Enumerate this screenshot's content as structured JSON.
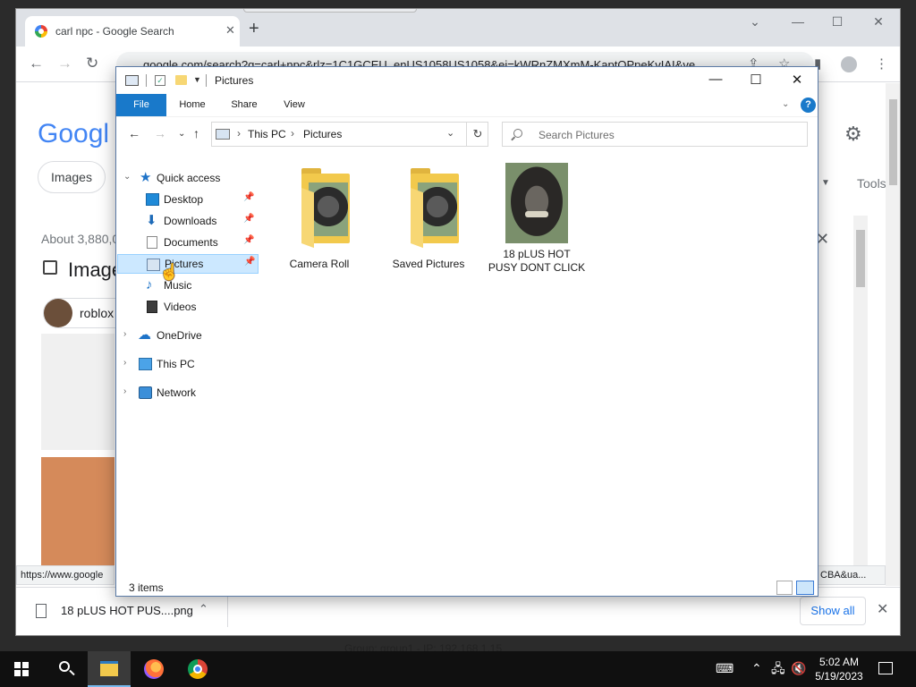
{
  "vm_caption": "Group: group1 - IP: 192.168.1.15",
  "chrome": {
    "tab_title": "carl npc - Google Search",
    "tab_close": "✕",
    "new_tab": "+",
    "url": "google.com/search?q=carl+npc&rlz=1C1GCEU_enUS1058US1058&ei=kWRnZMXmM-KaptQPpeKvIAI&ve",
    "status_url": "https://www.google",
    "status_url_right": "CBA&ua...",
    "page": {
      "logo": "Googl",
      "chip_images": "Images",
      "about": "About 3,880,0",
      "images_heading": "Image",
      "roblox_chip": "roblox",
      "tools": "Tools"
    },
    "download": {
      "filename": "18 pLUS HOT PUS....png",
      "show_all": "Show all"
    }
  },
  "explorer": {
    "window_title": "Pictures",
    "ribbon_tabs": [
      "File",
      "Home",
      "Share",
      "View"
    ],
    "breadcrumb": [
      "This PC",
      "Pictures"
    ],
    "search_placeholder": "Search Pictures",
    "nav": {
      "quick_access": "Quick access",
      "desktop": "Desktop",
      "downloads": "Downloads",
      "documents": "Documents",
      "pictures": "Pictures",
      "music": "Music",
      "videos": "Videos",
      "onedrive": "OneDrive",
      "this_pc": "This PC",
      "network": "Network"
    },
    "items": [
      {
        "name": "Camera Roll",
        "type": "folder"
      },
      {
        "name": "Saved Pictures",
        "type": "folder"
      },
      {
        "name": "18 pLUS HOT PUSY DONT CLICK",
        "type": "image"
      }
    ],
    "status": "3 items",
    "selected_nav": "Pictures"
  },
  "taskbar": {
    "time": "5:02 AM",
    "date": "5/19/2023",
    "pinned": [
      "file-explorer",
      "firefox",
      "chrome"
    ]
  },
  "colors": {
    "file_tab": "#1979ca",
    "selection": "#cce8ff",
    "taskbar": "#101010"
  }
}
